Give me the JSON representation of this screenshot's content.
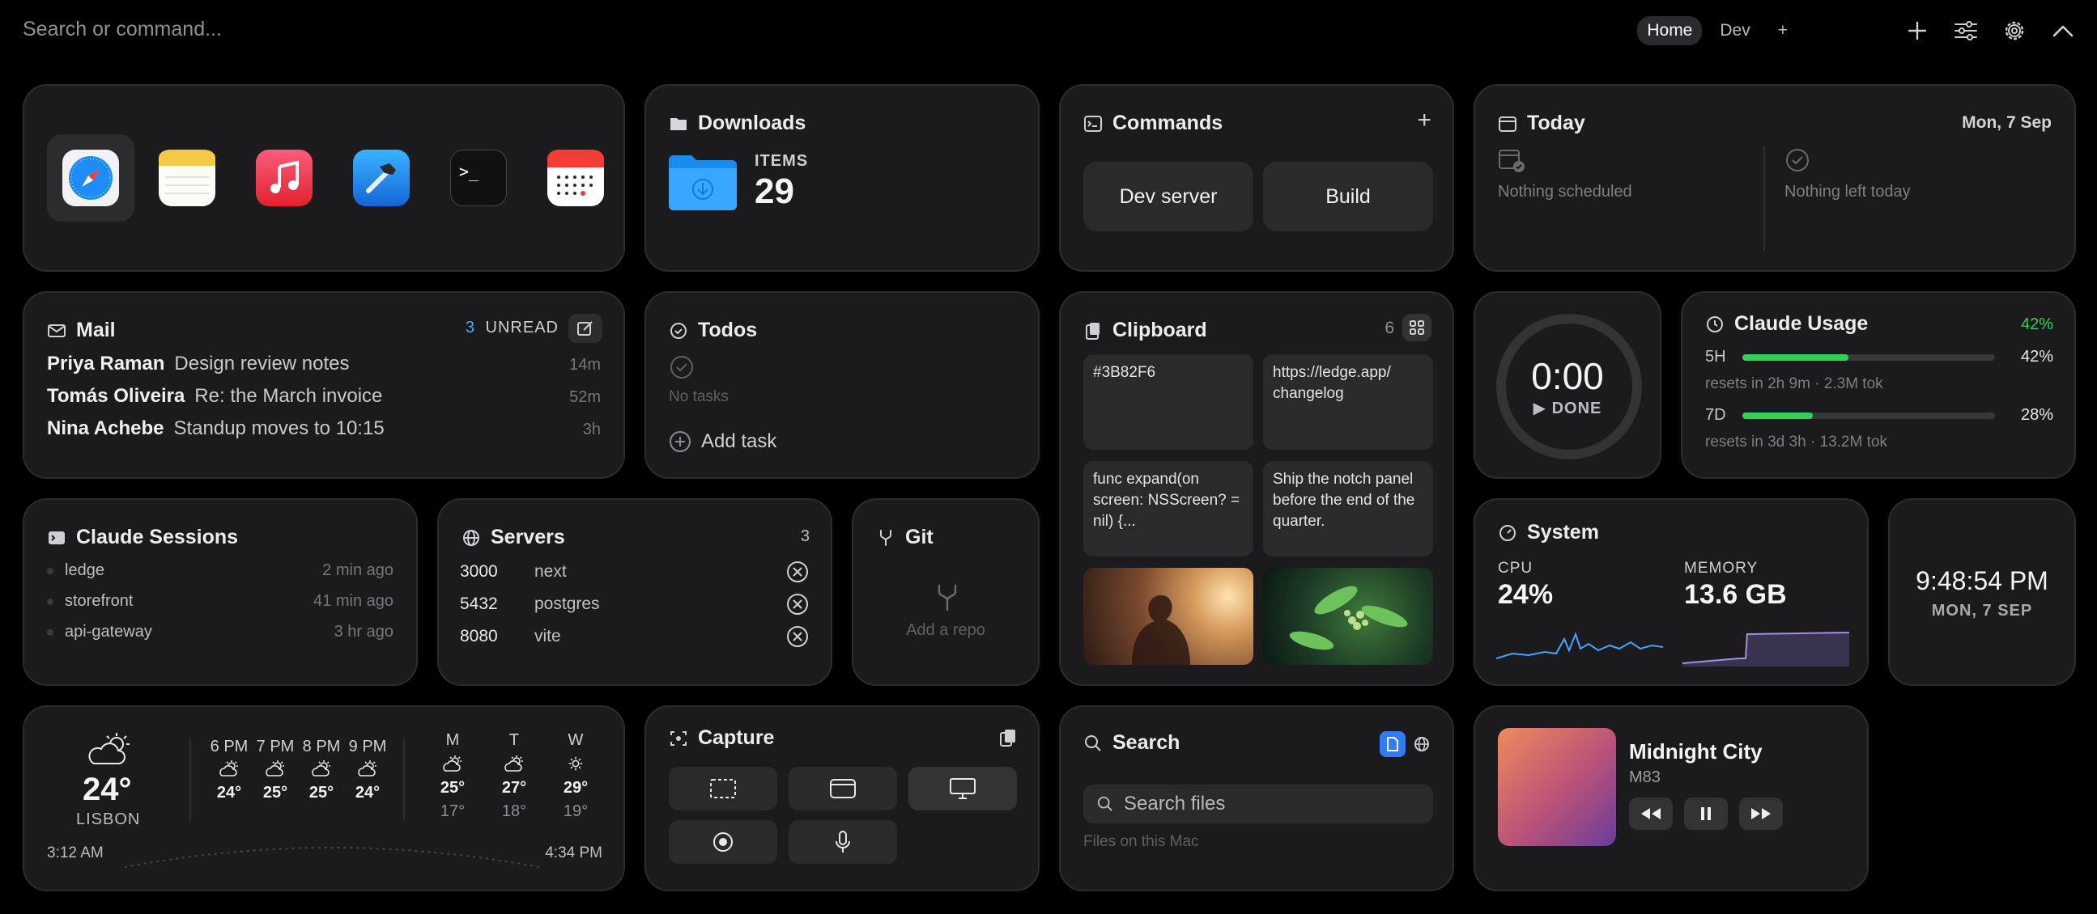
{
  "topbar": {
    "search_placeholder": "Search or command...",
    "tabs": [
      "Home",
      "Dev",
      "+"
    ],
    "active_tab": "Home"
  },
  "dock": {
    "apps": [
      "safari-icon",
      "notes-icon",
      "music-icon",
      "xcode-icon",
      "terminal-icon",
      "calendar-icon"
    ]
  },
  "downloads": {
    "title": "Downloads",
    "items_label": "ITEMS",
    "items_count": "29"
  },
  "commands": {
    "title": "Commands",
    "add": "+",
    "buttons": [
      "Dev server",
      "Build"
    ]
  },
  "today": {
    "title": "Today",
    "date": "Mon, 7 Sep",
    "left_text": "Nothing scheduled",
    "right_text": "Nothing left today"
  },
  "mail": {
    "title": "Mail",
    "unread_count": "3",
    "unread_label": "UNREAD",
    "messages": [
      {
        "from": "Priya Raman",
        "subject": "Design review notes",
        "time": "14m"
      },
      {
        "from": "Tomás Oliveira",
        "subject": "Re: the March invoice",
        "time": "52m"
      },
      {
        "from": "Nina Achebe",
        "subject": "Standup moves to 10:15",
        "time": "3h"
      }
    ]
  },
  "todos": {
    "title": "Todos",
    "empty": "No tasks",
    "add": "Add task"
  },
  "clipboard": {
    "title": "Clipboard",
    "count": "6",
    "items": [
      "#3B82F6",
      "https://ledge.app/ changelog",
      "func expand(on screen: NSScreen? = nil) {...",
      "Ship the notch panel before the end of the quarter."
    ]
  },
  "timer": {
    "time": "0:00",
    "status": "▶ DONE"
  },
  "claude_usage": {
    "title": "Claude Usage",
    "overall": "42%",
    "rows": [
      {
        "label": "5H",
        "percent": "42%",
        "fraction": 0.42,
        "detail": "resets in 2h 9m · 2.3M tok"
      },
      {
        "label": "7D",
        "percent": "28%",
        "fraction": 0.28,
        "detail": "resets in 3d 3h · 13.2M tok"
      }
    ],
    "accent": "#30d158"
  },
  "sessions": {
    "title": "Claude Sessions",
    "rows": [
      {
        "name": "ledge",
        "time": "2 min ago"
      },
      {
        "name": "storefront",
        "time": "41 min ago"
      },
      {
        "name": "api-gateway",
        "time": "3 hr ago"
      }
    ]
  },
  "servers": {
    "title": "Servers",
    "count": "3",
    "rows": [
      {
        "port": "3000",
        "name": "next"
      },
      {
        "port": "5432",
        "name": "postgres"
      },
      {
        "port": "8080",
        "name": "vite"
      }
    ]
  },
  "git": {
    "title": "Git",
    "empty": "Add a repo"
  },
  "system": {
    "title": "System",
    "cpu_label": "CPU",
    "cpu_value": "24%",
    "mem_label": "MEMORY",
    "mem_value": "13.6 GB",
    "cpu_color": "#4aa3ff",
    "mem_color": "#a98be8"
  },
  "clock": {
    "time": "9:48:54 PM",
    "date": "MON, 7 SEP"
  },
  "weather": {
    "temp": "24°",
    "city": "LISBON",
    "hours": [
      {
        "label": "6 PM",
        "temp": "24°"
      },
      {
        "label": "7 PM",
        "temp": "25°"
      },
      {
        "label": "8 PM",
        "temp": "25°"
      },
      {
        "label": "9 PM",
        "temp": "24°"
      }
    ],
    "days": [
      {
        "label": "M",
        "high": "25°",
        "low": "17°"
      },
      {
        "label": "T",
        "high": "27°",
        "low": "18°"
      },
      {
        "label": "W",
        "high": "29°",
        "low": "19°"
      }
    ],
    "sunrise": "3:12 AM",
    "sunset": "4:34 PM"
  },
  "capture": {
    "title": "Capture"
  },
  "search": {
    "title": "Search",
    "placeholder": "Search files",
    "hint": "Files on this Mac"
  },
  "nowplaying": {
    "track": "Midnight City",
    "artist": "M83"
  }
}
